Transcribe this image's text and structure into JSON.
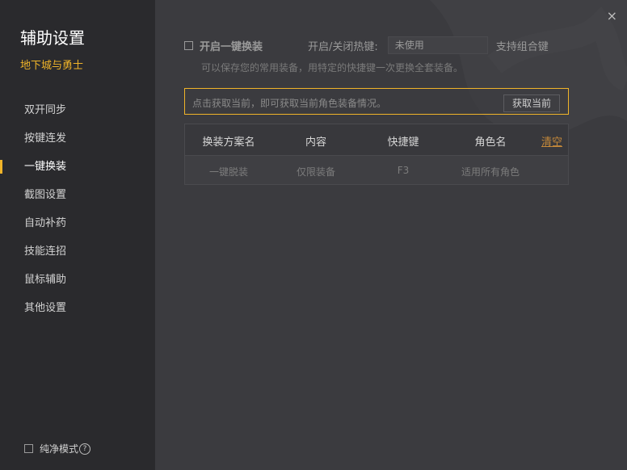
{
  "sidebar": {
    "title": "辅助设置",
    "game": "地下城与勇士",
    "items": [
      {
        "label": "双开同步"
      },
      {
        "label": "按键连发"
      },
      {
        "label": "一键换装",
        "active": true
      },
      {
        "label": "截图设置"
      },
      {
        "label": "自动补药"
      },
      {
        "label": "技能连招"
      },
      {
        "label": "鼠标辅助"
      },
      {
        "label": "其他设置"
      }
    ],
    "pure_mode": "纯净模式",
    "help_glyph": "?"
  },
  "main": {
    "close_glyph": "×",
    "enable_label": "开启一键换装",
    "hotkey_label": "开启/关闭热键:",
    "hotkey_value": "未使用",
    "combo_label": "支持组合键",
    "description": "可以保存您的常用装备，用特定的快捷键一次更换全套装备。",
    "fetch_text": "点击获取当前，即可获取当前角色装备情况。",
    "fetch_button": "获取当前",
    "table": {
      "headers": [
        "换装方案名",
        "内容",
        "快捷键",
        "角色名"
      ],
      "clear": "清空",
      "rows": [
        [
          "一键脱装",
          "仅限装备",
          "F3",
          "适用所有角色"
        ]
      ]
    }
  },
  "colors": {
    "accent": "#f0b429",
    "sidebar_bg": "#2a2a2d",
    "main_bg": "#3b3b3f",
    "link": "#c5893a"
  }
}
